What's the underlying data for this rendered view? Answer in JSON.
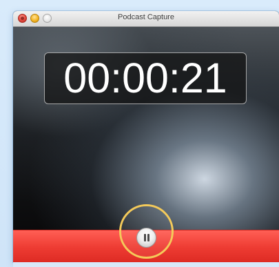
{
  "window": {
    "title": "Podcast Capture"
  },
  "recording": {
    "elapsed_time": "00:00:21"
  },
  "controls": {
    "pause_icon": "pause-icon"
  },
  "colors": {
    "control_bar": "#ee3c33",
    "highlight_ring": "#f4ca5a"
  }
}
